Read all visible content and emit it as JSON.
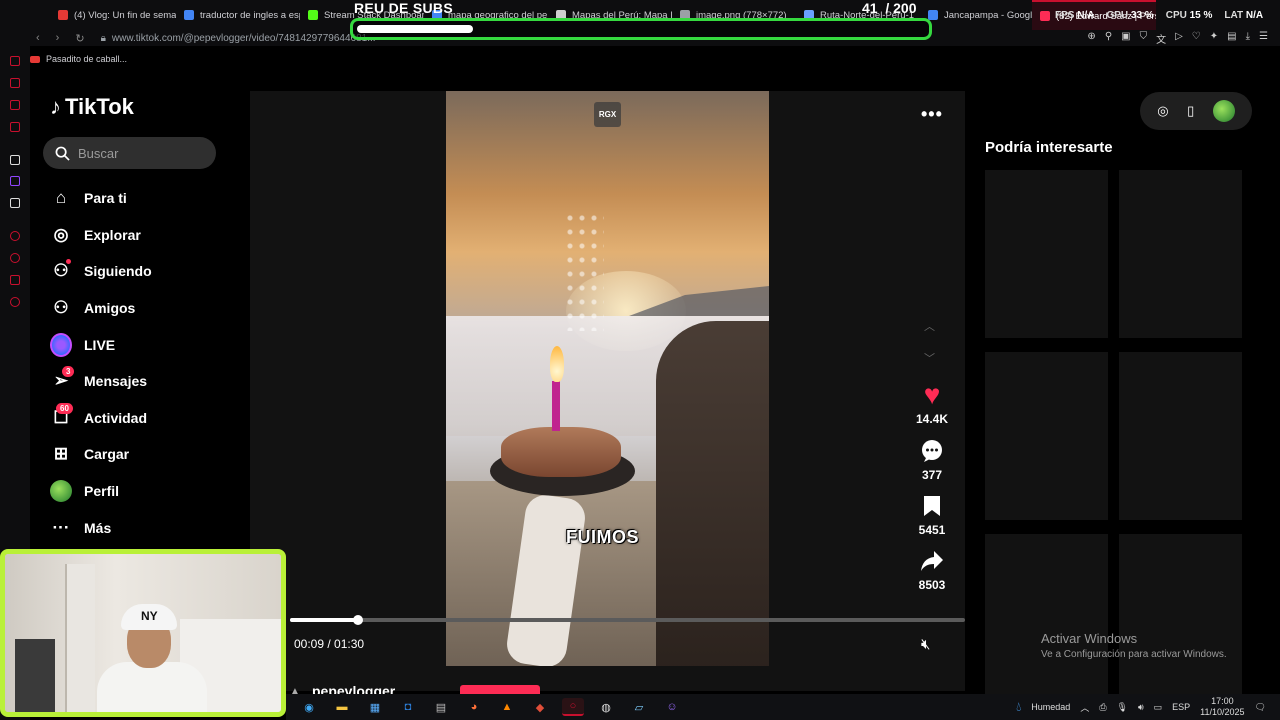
{
  "browser": {
    "tabs": [
      {
        "label": "(4) Vlog: Un fin de sema",
        "icon": "youtube-icon",
        "color": "#e53935"
      },
      {
        "label": "traductor de ingles a esp",
        "icon": "google-icon",
        "color": "#4285f4"
      },
      {
        "label": "Stream Stack Dashboard",
        "icon": "kick-icon",
        "color": "#53fc18"
      },
      {
        "label": "mapa geografico del pe",
        "icon": "google-icon",
        "color": "#4285f4"
      },
      {
        "label": "Mapas del Perú: Mapa I",
        "icon": "web-icon",
        "color": "#cfcfcf"
      },
      {
        "label": "image.png (778×772)",
        "icon": "file-icon",
        "color": "#9aa0a6"
      },
      {
        "label": "Ruta-Norte-del-Peru-1",
        "icon": "web-icon",
        "color": "#6aa0ff"
      },
      {
        "label": "Jancapampa - Google M",
        "icon": "google-icon",
        "color": "#4285f4"
      },
      {
        "label": "(82) Edward Sanz | Pers",
        "icon": "tiktok-icon",
        "color": "#fe2c55"
      }
    ],
    "url": "www.tiktok.com/@pepevlogger/video/7481429779644681...",
    "bookmark": "Pasadito de caball..."
  },
  "overlay": {
    "title": "REU DE SUBS",
    "count": "41",
    "goal": "/ 200",
    "progress": 0.205,
    "fps_label": "FPS",
    "fps_value": "N/A",
    "gpu_label": "GPU",
    "gpu_value": "33 %",
    "cpu_label": "CPU",
    "cpu_value": "15 %",
    "lat_label": "LAT",
    "lat_value": "N/A"
  },
  "sidebar": {
    "logo": "TikTok",
    "search_placeholder": "Buscar",
    "items": [
      {
        "label": "Para ti",
        "icon": "home-icon",
        "glyph": "⌂"
      },
      {
        "label": "Explorar",
        "icon": "compass-icon",
        "glyph": "◎"
      },
      {
        "label": "Siguiendo",
        "icon": "following-icon",
        "glyph": "⚇"
      },
      {
        "label": "Amigos",
        "icon": "friends-icon",
        "glyph": "⚇"
      },
      {
        "label": "LIVE",
        "icon": "live-icon",
        "glyph": ""
      },
      {
        "label": "Mensajes",
        "icon": "messages-icon",
        "glyph": "➢",
        "badge": "3"
      },
      {
        "label": "Actividad",
        "icon": "activity-icon",
        "glyph": "☐",
        "badge": "60"
      },
      {
        "label": "Cargar",
        "icon": "upload-icon",
        "glyph": "⊞"
      },
      {
        "label": "Perfil",
        "icon": "avatar-icon",
        "glyph": ""
      },
      {
        "label": "Más",
        "icon": "more-icon",
        "glyph": "···"
      }
    ]
  },
  "video": {
    "watermark": "RGX",
    "caption": "FUIMOS",
    "current_time": "00:09",
    "duration": "01:30",
    "progress": 0.1,
    "author": "pepevlogger",
    "likes": "14.4K",
    "comments": "377",
    "saves": "5451",
    "shares": "8503"
  },
  "suggestions": {
    "title": "Podría interesarte"
  },
  "windows": {
    "activate_title": "Activar Windows",
    "activate_sub": "Ve a Configuración para activar Windows.",
    "weather": "Humedad",
    "lang": "ESP",
    "time": "17:00",
    "date": "11/10/2025"
  },
  "colors": {
    "accent": "#fe2c55",
    "overlay_green": "#35d93f",
    "cam_border": "#b9f038",
    "opera_red": "#c8102e"
  }
}
